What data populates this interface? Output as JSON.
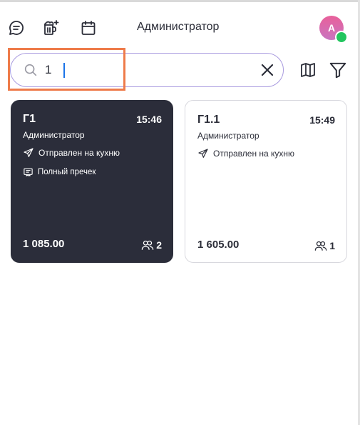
{
  "header": {
    "title": "Администратор",
    "avatar_letter": "A",
    "icons": [
      "chat-icon",
      "beer-add-icon",
      "calendar-icon"
    ]
  },
  "search": {
    "value": "1",
    "placeholder": ""
  },
  "orders": [
    {
      "name": "Г1",
      "time": "15:46",
      "user": "Администратор",
      "status": "Отправлен на кухню",
      "precheck": "Полный пречек",
      "sum": "1 085.00",
      "guests": "2",
      "selected": true
    },
    {
      "name": "Г1.1",
      "time": "15:49",
      "user": "Администратор",
      "status": "Отправлен на кухню",
      "precheck": "",
      "sum": "1 605.00",
      "guests": "1",
      "selected": false
    }
  ],
  "colors": {
    "dark_card": "#2b2d3a",
    "accent_highlight": "#ee7b4a",
    "search_border": "#a99bdf",
    "online": "#22c55e"
  }
}
